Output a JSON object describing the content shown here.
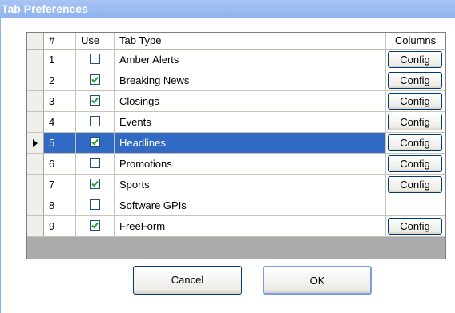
{
  "window": {
    "title": "Tab Preferences"
  },
  "grid": {
    "headers": {
      "number": "#",
      "use": "Use",
      "tab_type": "Tab Type",
      "columns": "Columns"
    },
    "config_label": "Config",
    "rows": [
      {
        "number": "1",
        "use": false,
        "tab_type": "Amber Alerts",
        "config": true,
        "selected": false
      },
      {
        "number": "2",
        "use": true,
        "tab_type": "Breaking News",
        "config": true,
        "selected": false
      },
      {
        "number": "3",
        "use": true,
        "tab_type": "Closings",
        "config": true,
        "selected": false
      },
      {
        "number": "4",
        "use": false,
        "tab_type": "Events",
        "config": true,
        "selected": false
      },
      {
        "number": "5",
        "use": true,
        "tab_type": "Headlines",
        "config": true,
        "selected": true
      },
      {
        "number": "6",
        "use": false,
        "tab_type": "Promotions",
        "config": true,
        "selected": false
      },
      {
        "number": "7",
        "use": true,
        "tab_type": "Sports",
        "config": true,
        "selected": false
      },
      {
        "number": "8",
        "use": false,
        "tab_type": "Software GPIs",
        "config": false,
        "selected": false
      },
      {
        "number": "9",
        "use": true,
        "tab_type": "FreeForm",
        "config": true,
        "selected": false
      }
    ]
  },
  "buttons": {
    "cancel": "Cancel",
    "ok": "OK"
  },
  "colors": {
    "selection": "#316ac5",
    "check": "#21a121",
    "title_bar": "#8eb2ee"
  }
}
